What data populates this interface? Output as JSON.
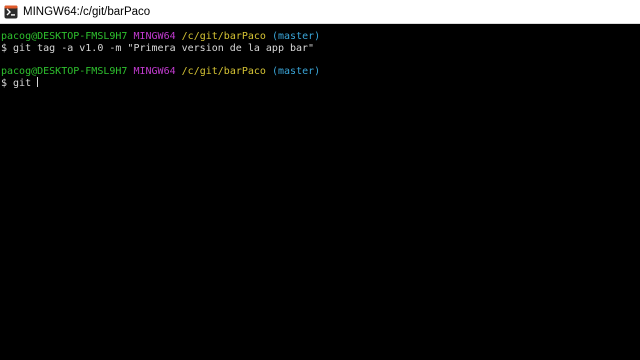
{
  "window": {
    "title": "MINGW64:/c/git/barPaco",
    "icon": "git-bash-icon"
  },
  "terminal": {
    "prompt1": {
      "user_host": "pacog@DESKTOP-FMSL9H7",
      "env": "MINGW64",
      "path": "/c/git/barPaco",
      "branch": "(master)"
    },
    "command1": "$ git tag -a v1.0 -m \"Primera version de la app bar\"",
    "prompt2": {
      "user_host": "pacog@DESKTOP-FMSL9H7",
      "env": "MINGW64",
      "path": "/c/git/barPaco",
      "branch": "(master)"
    },
    "command2": "$ git "
  },
  "colors": {
    "background": "#000000",
    "user_host": "#2ec12e",
    "env": "#c23bd0",
    "path": "#d6c434",
    "branch": "#3aa6d9",
    "text": "#d8d8d8"
  }
}
